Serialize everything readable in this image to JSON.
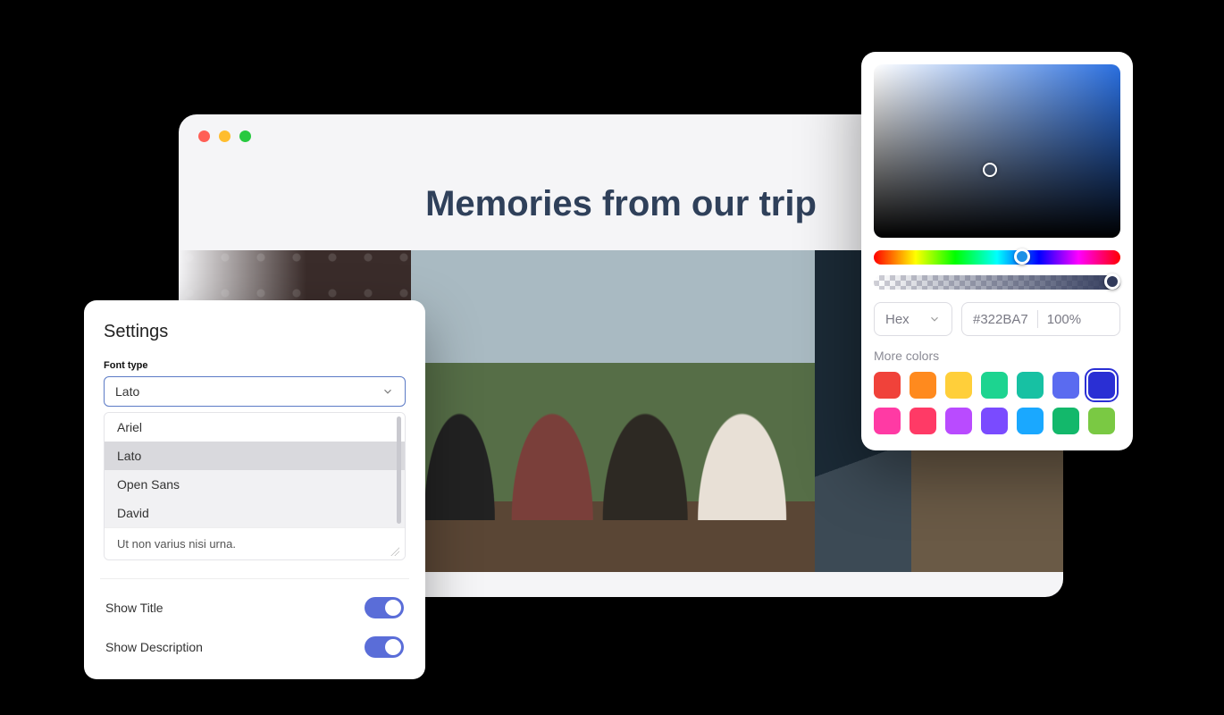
{
  "preview": {
    "title": "Memories from our trip"
  },
  "settings": {
    "title": "Settings",
    "font_type_label": "Font type",
    "font_selected": "Lato",
    "font_options": [
      "Ariel",
      "Lato",
      "Open Sans",
      "David"
    ],
    "sample_text": "Ut non varius nisi urna.",
    "toggles": {
      "show_title": {
        "label": "Show Title",
        "on": true
      },
      "show_description": {
        "label": "Show Description",
        "on": true
      }
    }
  },
  "color_picker": {
    "format_label": "Hex",
    "hex_value": "#322BA7",
    "opacity_value": "100%",
    "more_colors_label": "More colors",
    "swatches_row1": [
      "#f0423a",
      "#ff8a1e",
      "#ffcf3a",
      "#1dd490",
      "#17c1a3",
      "#5a6bf0",
      "#2a2fd4"
    ],
    "swatches_row2": [
      "#ff3aa4",
      "#ff3a66",
      "#b94bff",
      "#7a4bff",
      "#1aa8ff",
      "#13b86b",
      "#7ac943"
    ],
    "selected_swatch_index": 6
  }
}
